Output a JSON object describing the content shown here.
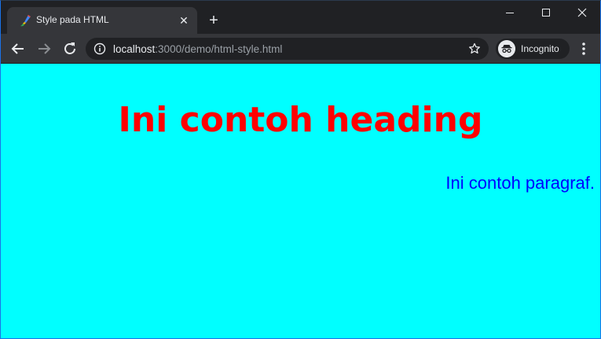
{
  "browser": {
    "tab": {
      "title": "Style pada HTML",
      "close_symbol": "✕",
      "favicon": "brush-favicon-icon"
    },
    "new_tab_symbol": "+",
    "window_controls": {
      "minimize": "minimize-icon",
      "maximize": "maximize-icon",
      "close": "close-window-icon"
    },
    "toolbar": {
      "back": "back-arrow-icon",
      "forward": "forward-arrow-icon",
      "reload": "reload-icon",
      "url_host": "localhost",
      "url_rest": ":3000/demo/html-style.html",
      "bookmark": "star-icon",
      "incognito_label": "Incognito",
      "menu": "kebab-menu-icon"
    },
    "colors": {
      "frame": "#202124",
      "toolbar": "#35363a",
      "text": "#e8eaed",
      "url_dim": "#9aa0a6"
    }
  },
  "page": {
    "heading": "Ini contoh heading",
    "paragraph": "Ini contoh paragraf.",
    "colors": {
      "background": "#00ffff",
      "heading": "#ff0000",
      "paragraph": "#0000ff"
    }
  }
}
